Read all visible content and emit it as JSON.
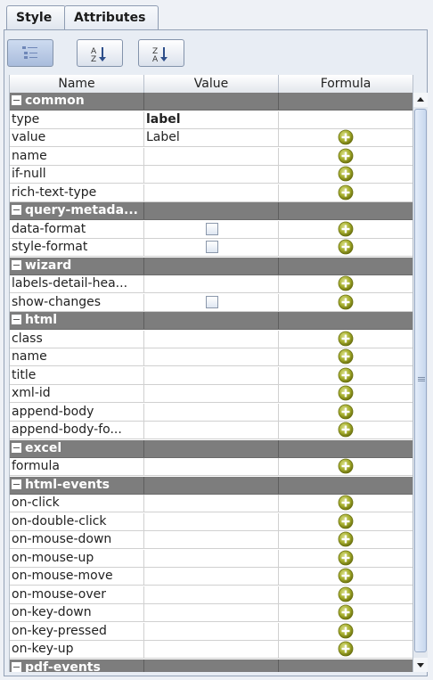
{
  "tabs": [
    "Style",
    "Attributes"
  ],
  "columns": {
    "name": "Name",
    "value": "Value",
    "formula": "Formula"
  },
  "rows": [
    {
      "group": true,
      "name": "common"
    },
    {
      "name": "type",
      "value": "label",
      "bold": true,
      "plus": false
    },
    {
      "name": "value",
      "value": "Label",
      "plus": true
    },
    {
      "name": "name",
      "plus": true
    },
    {
      "name": "if-null",
      "plus": true
    },
    {
      "name": "rich-text-type",
      "plus": true
    },
    {
      "group": true,
      "name": "query-metada..."
    },
    {
      "name": "data-format",
      "checkbox": true,
      "plus": true
    },
    {
      "name": "style-format",
      "checkbox": true,
      "plus": true
    },
    {
      "group": true,
      "name": "wizard"
    },
    {
      "name": "labels-detail-hea...",
      "plus": true
    },
    {
      "name": "show-changes",
      "checkbox": true,
      "plus": true
    },
    {
      "group": true,
      "name": "html"
    },
    {
      "name": "class",
      "plus": true
    },
    {
      "name": "name",
      "plus": true
    },
    {
      "name": "title",
      "plus": true
    },
    {
      "name": "xml-id",
      "plus": true
    },
    {
      "name": "append-body",
      "plus": true
    },
    {
      "name": "append-body-fo...",
      "plus": true
    },
    {
      "group": true,
      "name": "excel"
    },
    {
      "name": "formula",
      "plus": true
    },
    {
      "group": true,
      "name": "html-events"
    },
    {
      "name": "on-click",
      "plus": true
    },
    {
      "name": "on-double-click",
      "plus": true
    },
    {
      "name": "on-mouse-down",
      "plus": true
    },
    {
      "name": "on-mouse-up",
      "plus": true
    },
    {
      "name": "on-mouse-move",
      "plus": true
    },
    {
      "name": "on-mouse-over",
      "plus": true
    },
    {
      "name": "on-key-down",
      "plus": true
    },
    {
      "name": "on-key-pressed",
      "plus": true
    },
    {
      "name": "on-key-up",
      "plus": true
    },
    {
      "group": true,
      "name": "pdf-events"
    }
  ]
}
